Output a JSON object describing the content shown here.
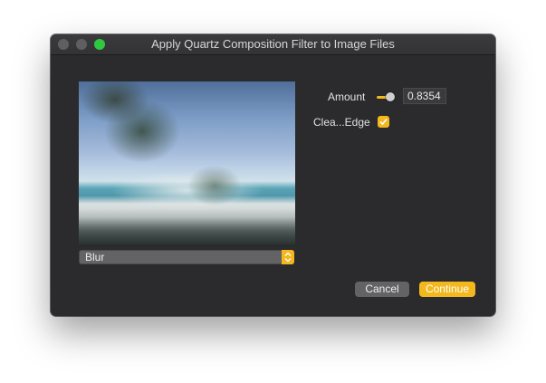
{
  "window": {
    "title": "Apply Quartz Composition Filter to Image Files"
  },
  "filter_popup": {
    "selected": "Blur"
  },
  "parameters": {
    "amount_label": "Amount",
    "amount_value": "0.8354",
    "edge_label": "Clea...Edge",
    "edge_checked": true
  },
  "buttons": {
    "cancel_label": "Cancel",
    "continue_label": "Continue"
  },
  "colors": {
    "accent": "#f2b81d",
    "window_bg": "#2b2b2d",
    "zoom_button": "#2fc840"
  }
}
